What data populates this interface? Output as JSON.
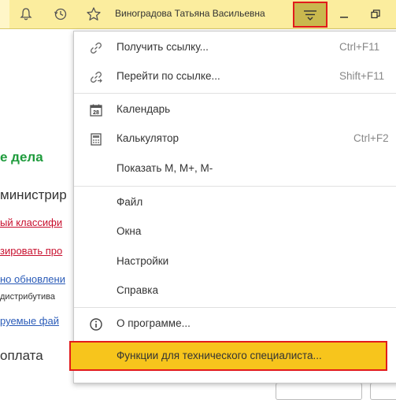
{
  "titlebar": {
    "user_name": "Виноградова Татьяна Васильевна",
    "icons": [
      "bell-icon",
      "history-icon",
      "star-icon",
      "menu-lines-icon",
      "minimize-icon",
      "restore-icon"
    ]
  },
  "background": {
    "heading": "е дела",
    "admin_text": "министрир",
    "link_1": "ый классифи",
    "link_2": "зировать про",
    "link_3": "но обновлени",
    "small_text": "дистрибутива",
    "link_4": "руемые фай",
    "payment_text": "оплата"
  },
  "menu": {
    "items": [
      {
        "label": "Получить ссылку...",
        "shortcut": "Ctrl+F11",
        "icon": "link-icon"
      },
      {
        "label": "Перейти по ссылке...",
        "shortcut": "Shift+F11",
        "icon": "goto-link-icon"
      },
      {
        "label": "Календарь",
        "shortcut": "",
        "icon": "calendar-icon",
        "icon_text": "28"
      },
      {
        "label": "Калькулятор",
        "shortcut": "Ctrl+F2",
        "icon": "calculator-icon"
      },
      {
        "label": "Показать М, М+, М-",
        "shortcut": "",
        "icon": ""
      },
      {
        "label": "Файл",
        "shortcut": "",
        "icon": ""
      },
      {
        "label": "Окна",
        "shortcut": "",
        "icon": ""
      },
      {
        "label": "Настройки",
        "shortcut": "",
        "icon": ""
      },
      {
        "label": "Справка",
        "shortcut": "",
        "icon": ""
      },
      {
        "label": "О программе...",
        "shortcut": "",
        "icon": "info-icon"
      },
      {
        "label": "Функции для технического специалиста...",
        "shortcut": "",
        "icon": ""
      }
    ]
  },
  "colors": {
    "titlebar_bg": "#fbed9e",
    "menu_button_active": "#c9b84e",
    "highlight": "#f7c51c",
    "annotation_red": "#e21b1b",
    "heading_green": "#1e9b3c"
  }
}
